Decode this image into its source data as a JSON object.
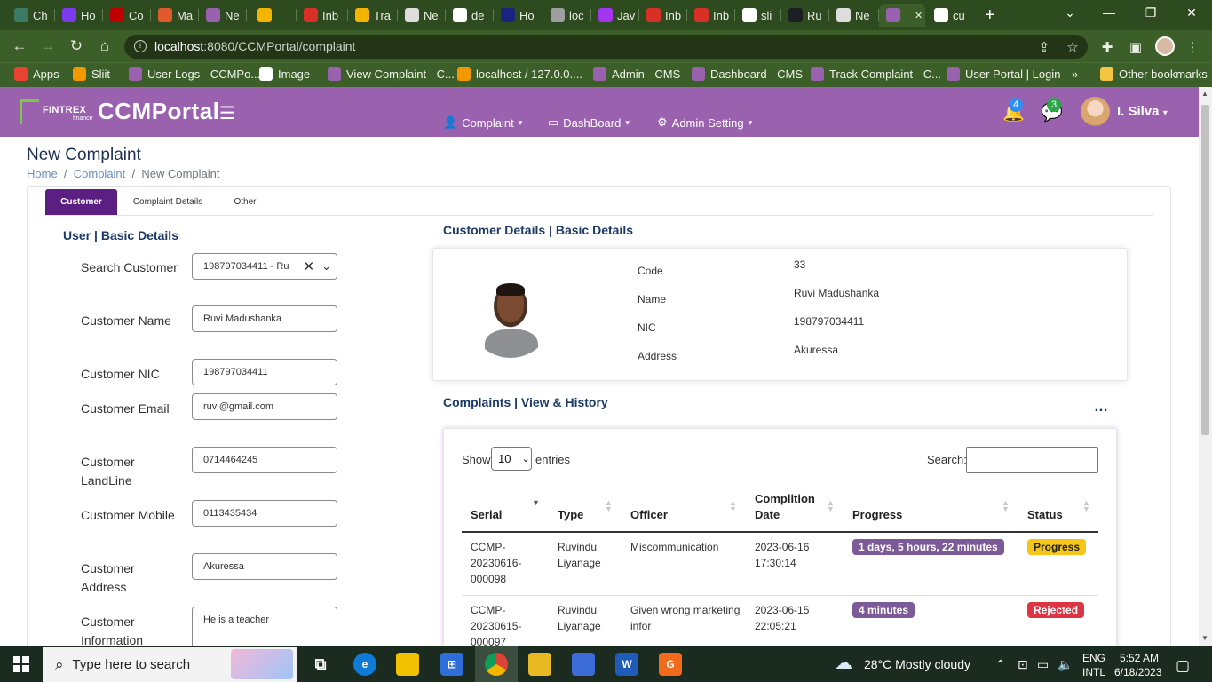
{
  "browser": {
    "tabs": [
      {
        "label": "Ch",
        "icon": "chatgpt-icon",
        "color": "#3b7a64"
      },
      {
        "label": "Ho",
        "icon": "bootstrap-icon",
        "color": "#7c3aed"
      },
      {
        "label": "Co",
        "icon": "red-circle-icon",
        "color": "#c00000"
      },
      {
        "label": "Ma",
        "icon": "code-icon",
        "color": "#e05b2b"
      },
      {
        "label": "Ne",
        "icon": "ccm-icon",
        "color": "#9a62ae"
      },
      {
        "label": "",
        "icon": "drive-icon",
        "color": "#f4b400"
      },
      {
        "label": "Inb",
        "icon": "gmail-icon",
        "color": "#d93025"
      },
      {
        "label": "Tra",
        "icon": "drive-icon",
        "color": "#f4b400"
      },
      {
        "label": "Ne",
        "icon": "chrome-icon",
        "color": "#dddddd"
      },
      {
        "label": "de",
        "icon": "google-icon",
        "color": "#ffffff"
      },
      {
        "label": "Ho",
        "icon": "moon-icon",
        "color": "#1a237e"
      },
      {
        "label": "loc",
        "icon": "page-icon",
        "color": "#9e9e9e"
      },
      {
        "label": "Jav",
        "icon": "u-icon",
        "color": "#a435f0"
      },
      {
        "label": "Inb",
        "icon": "gmail-icon",
        "color": "#d93025"
      },
      {
        "label": "Inb",
        "icon": "gmail-icon",
        "color": "#d93025"
      },
      {
        "label": "sli",
        "icon": "google-icon",
        "color": "#ffffff"
      },
      {
        "label": "Ru",
        "icon": "github-icon",
        "color": "#1b1f23"
      },
      {
        "label": "Ne",
        "icon": "chrome-icon",
        "color": "#dddddd"
      },
      {
        "label": "",
        "icon": "ccm-icon",
        "color": "#9a62ae",
        "active": true
      },
      {
        "label": "cu",
        "icon": "google-icon",
        "color": "#ffffff"
      }
    ],
    "url_host": "localhost",
    "url_path": ":8080/CCMPortal/complaint",
    "bookmarks": [
      {
        "label": "Apps",
        "color": "#e94235"
      },
      {
        "label": "Sliit",
        "color": "#f29900"
      },
      {
        "label": "User Logs - CCMPo...",
        "color": "#9a62ae"
      },
      {
        "label": "Image",
        "color": "#ffffff"
      },
      {
        "label": "View Complaint - C...",
        "color": "#9a62ae"
      },
      {
        "label": "localhost / 127.0.0....",
        "color": "#f29900"
      },
      {
        "label": "Admin - CMS",
        "color": "#9a62ae"
      },
      {
        "label": "Dashboard - CMS",
        "color": "#9a62ae"
      },
      {
        "label": "Track Complaint - C...",
        "color": "#9a62ae"
      },
      {
        "label": "User Portal | Login",
        "color": "#9a62ae"
      }
    ],
    "more_bookmarks": "»",
    "other_bookmarks": "Other bookmarks"
  },
  "header": {
    "logo_brand": "FINTREX",
    "logo_sub": "finance",
    "app_title": "CCMPortal",
    "menu": [
      "Complaint",
      "DashBoard",
      "Admin Setting"
    ],
    "notifications_count": "4",
    "messages_count": "3",
    "username": "I. Silva",
    "colors": {
      "header_bg": "#9a62ae",
      "logo_green": "#7ac943"
    }
  },
  "page": {
    "title": "New Complaint",
    "breadcrumb": [
      "Home",
      "Complaint",
      "New Complaint"
    ],
    "tabs": [
      "Customer",
      "Complaint Details",
      "Other"
    ],
    "active_tab": "Customer",
    "tab_active_color": "#5a1f80"
  },
  "form": {
    "section_title": "User | Basic Details",
    "search_label": "Search Customer",
    "search_value": "198797034411 - Ru",
    "fields": [
      {
        "label": "Customer Name",
        "value": "Ruvi Madushanka"
      },
      {
        "label": "Customer NIC",
        "value": "198797034411"
      },
      {
        "label": "Customer Email",
        "value": "ruvi@gmail.com"
      },
      {
        "label": "Customer LandLine",
        "value": "0714464245"
      },
      {
        "label": "Customer Mobile",
        "value": "0113435434"
      },
      {
        "label": "Customer Address",
        "value": "Akuressa"
      },
      {
        "label": "Customer Information",
        "value": "He is a teacher"
      }
    ]
  },
  "customer_details": {
    "section_title": "Customer Details | Basic Details",
    "rows": [
      {
        "label": "Code",
        "value": "33"
      },
      {
        "label": "Name",
        "value": "Ruvi Madushanka"
      },
      {
        "label": "NIC",
        "value": "198797034411"
      },
      {
        "label": "Address",
        "value": "Akuressa"
      }
    ]
  },
  "complaints": {
    "section_title": "Complaints | View & History",
    "more_icon": "…",
    "show_label": "Show",
    "entries_value": "10",
    "entries_label": "entries",
    "search_label": "Search:",
    "columns": [
      "Serial",
      "Type",
      "Officer",
      "Complition Date",
      "Progress",
      "Status"
    ],
    "rows": [
      {
        "serial": "CCMP-20230616-000098",
        "type": "Ruvindu Liyanage",
        "officer": "Miscommunication",
        "date": "2023-06-16 17:30:14",
        "progress": "1 days, 5 hours, 22 minutes",
        "status": "Progress",
        "status_color": "#f5c518",
        "status_text_color": "#222222"
      },
      {
        "serial": "CCMP-20230615-000097",
        "type": "Ruvindu Liyanage",
        "officer": "Given wrong marketing infor",
        "date": "2023-06-15 22:05:21",
        "progress": "4 minutes",
        "status": "Rejected",
        "status_color": "#dc3545",
        "status_text_color": "#ffffff"
      }
    ]
  },
  "taskbar": {
    "search_placeholder": "Type here to search",
    "weather": "28°C  Mostly cloudy",
    "lang_1": "ENG",
    "lang_2": "INTL",
    "time": "5:52 AM",
    "date": "6/18/2023"
  }
}
